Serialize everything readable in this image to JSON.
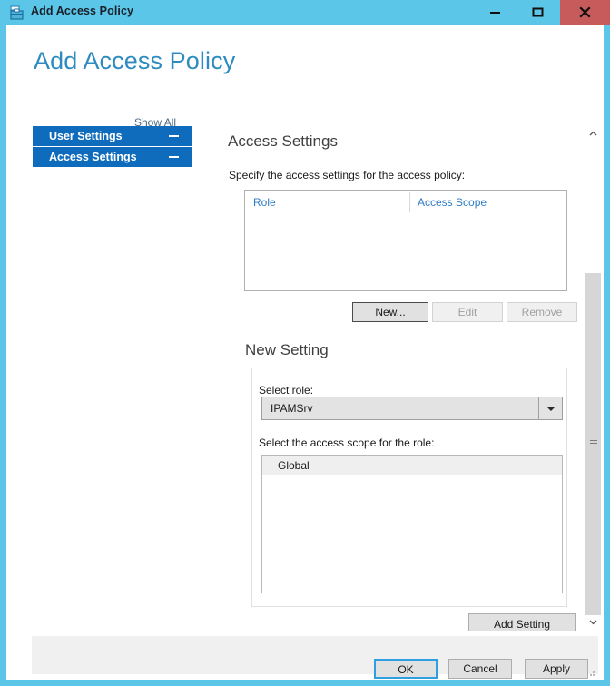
{
  "window": {
    "title": "Add Access Policy",
    "icon": "access-policy-icon",
    "controls": {
      "minimize": "minimize-icon",
      "maximize": "maximize-icon",
      "close": "close-icon"
    },
    "colors": {
      "frame": "#5bc6e8",
      "close_button": "#c75b5b",
      "accent": "#2e8bc0",
      "nav_selected": "#0f6cbd",
      "link": "#2e7cc4"
    }
  },
  "page": {
    "title": "Add Access Policy"
  },
  "sidebar": {
    "show_all_label": "Show All",
    "items": [
      {
        "label": "User Settings",
        "toggle": "collapse-icon"
      },
      {
        "label": "Access Settings",
        "toggle": "collapse-icon"
      }
    ]
  },
  "main": {
    "access_settings": {
      "heading": "Access Settings",
      "instruction": "Specify the access settings for the access policy:",
      "grid": {
        "columns": [
          "Role",
          "Access Scope"
        ],
        "rows": []
      },
      "buttons": {
        "new": "New...",
        "edit": "Edit",
        "remove": "Remove"
      }
    },
    "new_setting": {
      "heading": "New Setting",
      "role_label": "Select role:",
      "role_value": "IPAMSrv",
      "role_arrow": "chevron-down-icon",
      "scope_label": "Select the access scope for the role:",
      "scope_items": [
        "Global"
      ],
      "add_button": "Add Setting"
    }
  },
  "scrollbar": {
    "up_arrow": "chevron-up-icon",
    "down_arrow": "chevron-down-icon",
    "thumb": "scrollbar-thumb"
  },
  "footer": {
    "ok": "OK",
    "cancel": "Cancel",
    "apply": "Apply"
  }
}
